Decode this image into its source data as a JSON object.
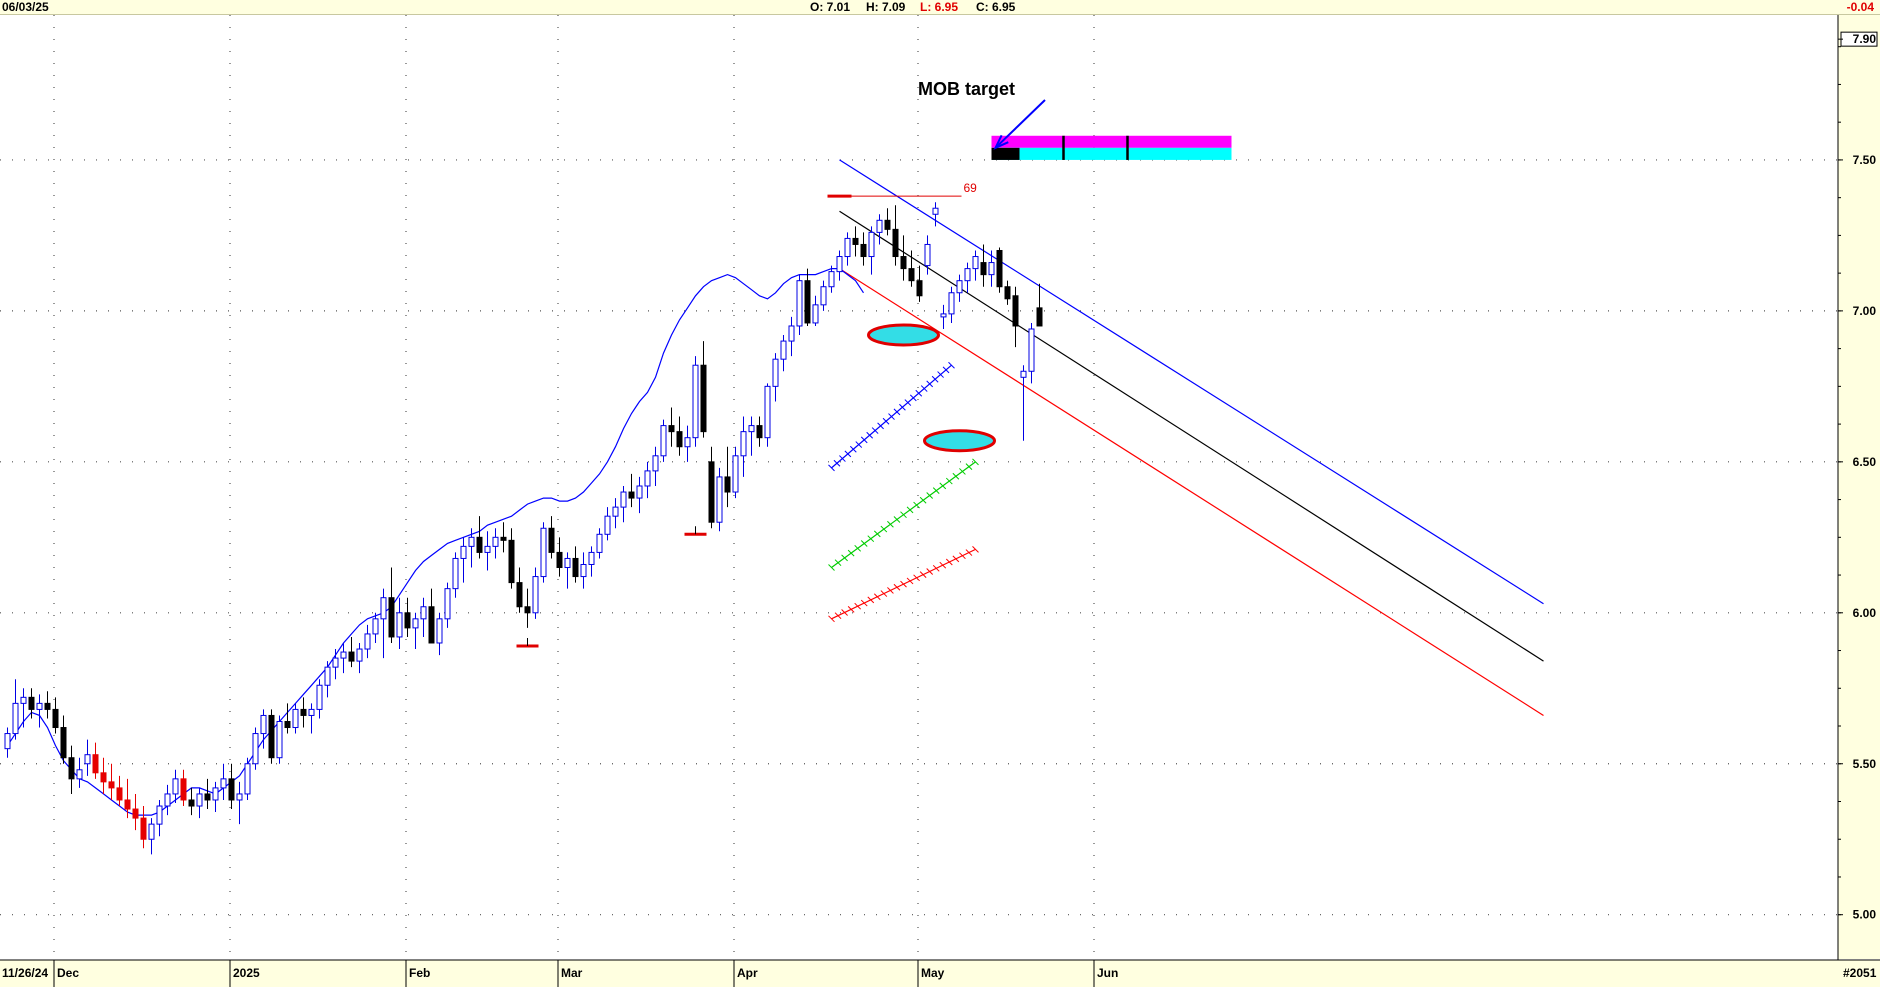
{
  "header": {
    "date": "06/03/25",
    "open": "O: 7.01",
    "high": "H: 7.09",
    "low": "L: 6.95",
    "close": "C: 6.95",
    "change": "-0.04"
  },
  "footer": {
    "start_date": "11/26/24",
    "chart_id": "#2051"
  },
  "annotations": {
    "mob_label": "MOB target",
    "swing_count": "69"
  },
  "colors": {
    "up_candle": "#0000e6",
    "down_candle": "#000000",
    "down_candle_alt": "#e60000",
    "moving_average": "#0000ff",
    "channel_upper": "#0000ff",
    "channel_mid": "#000000",
    "channel_lower": "#ff0000",
    "target_magenta": "#ff00ff",
    "target_cyan": "#00ffff",
    "header_bg": "#ffffe0"
  },
  "chart_data": {
    "type": "candlestick",
    "ylim": [
      4.85,
      7.98
    ],
    "y_ticks": [
      "7.90",
      "7.50",
      "7.00",
      "6.50",
      "6.00",
      "5.50",
      "5.00"
    ],
    "x_months": [
      "Dec",
      "2025",
      "Feb",
      "Mar",
      "Apr",
      "May",
      "Jun"
    ],
    "ohlc": [
      [
        5.55,
        5.62,
        5.52,
        5.6
      ],
      [
        5.6,
        5.78,
        5.58,
        5.7
      ],
      [
        5.7,
        5.75,
        5.62,
        5.72
      ],
      [
        5.72,
        5.75,
        5.65,
        5.68
      ],
      [
        5.68,
        5.73,
        5.62,
        5.7
      ],
      [
        5.7,
        5.74,
        5.65,
        5.68
      ],
      [
        5.68,
        5.72,
        5.6,
        5.62
      ],
      [
        5.62,
        5.66,
        5.5,
        5.52
      ],
      [
        5.52,
        5.56,
        5.4,
        5.45
      ],
      [
        5.45,
        5.52,
        5.42,
        5.48
      ],
      [
        5.5,
        5.58,
        5.46,
        5.53
      ],
      [
        5.53,
        5.57,
        5.45,
        5.47
      ],
      [
        5.47,
        5.52,
        5.4,
        5.44
      ],
      [
        5.44,
        5.5,
        5.38,
        5.42
      ],
      [
        5.42,
        5.46,
        5.36,
        5.38
      ],
      [
        5.38,
        5.45,
        5.32,
        5.35
      ],
      [
        5.35,
        5.4,
        5.28,
        5.32
      ],
      [
        5.32,
        5.36,
        5.22,
        5.25
      ],
      [
        5.25,
        5.32,
        5.2,
        5.3
      ],
      [
        5.3,
        5.38,
        5.26,
        5.36
      ],
      [
        5.36,
        5.43,
        5.33,
        5.4
      ],
      [
        5.4,
        5.48,
        5.37,
        5.45
      ],
      [
        5.45,
        5.48,
        5.36,
        5.38
      ],
      [
        5.38,
        5.42,
        5.33,
        5.36
      ],
      [
        5.36,
        5.42,
        5.32,
        5.4
      ],
      [
        5.4,
        5.45,
        5.35,
        5.38
      ],
      [
        5.38,
        5.44,
        5.34,
        5.42
      ],
      [
        5.42,
        5.5,
        5.38,
        5.45
      ],
      [
        5.45,
        5.5,
        5.35,
        5.38
      ],
      [
        5.38,
        5.44,
        5.3,
        5.4
      ],
      [
        5.4,
        5.52,
        5.38,
        5.5
      ],
      [
        5.5,
        5.62,
        5.48,
        5.6
      ],
      [
        5.6,
        5.68,
        5.55,
        5.66
      ],
      [
        5.66,
        5.68,
        5.5,
        5.52
      ],
      [
        5.52,
        5.66,
        5.5,
        5.64
      ],
      [
        5.64,
        5.7,
        5.6,
        5.62
      ],
      [
        5.62,
        5.7,
        5.6,
        5.68
      ],
      [
        5.68,
        5.72,
        5.62,
        5.66
      ],
      [
        5.66,
        5.7,
        5.6,
        5.68
      ],
      [
        5.68,
        5.78,
        5.65,
        5.76
      ],
      [
        5.76,
        5.84,
        5.72,
        5.82
      ],
      [
        5.82,
        5.88,
        5.78,
        5.85
      ],
      [
        5.85,
        5.9,
        5.8,
        5.87
      ],
      [
        5.87,
        5.92,
        5.82,
        5.84
      ],
      [
        5.84,
        5.9,
        5.8,
        5.88
      ],
      [
        5.88,
        5.96,
        5.85,
        5.93
      ],
      [
        5.93,
        6.0,
        5.9,
        5.98
      ],
      [
        5.98,
        6.08,
        5.85,
        6.05
      ],
      [
        6.05,
        6.15,
        5.9,
        5.92
      ],
      [
        5.92,
        6.05,
        5.88,
        6.0
      ],
      [
        6.0,
        6.05,
        5.92,
        5.95
      ],
      [
        5.95,
        6.0,
        5.88,
        5.98
      ],
      [
        5.98,
        6.05,
        5.92,
        6.02
      ],
      [
        6.02,
        6.08,
        5.98,
        5.9
      ],
      [
        5.9,
        6.0,
        5.86,
        5.98
      ],
      [
        5.98,
        6.1,
        5.95,
        6.08
      ],
      [
        6.08,
        6.2,
        6.05,
        6.18
      ],
      [
        6.18,
        6.25,
        6.1,
        6.22
      ],
      [
        6.22,
        6.28,
        6.15,
        6.25
      ],
      [
        6.25,
        6.32,
        6.18,
        6.2
      ],
      [
        6.2,
        6.27,
        6.14,
        6.22
      ],
      [
        6.22,
        6.28,
        6.18,
        6.25
      ],
      [
        6.25,
        6.3,
        6.2,
        6.24
      ],
      [
        6.24,
        6.28,
        6.08,
        6.1
      ],
      [
        6.1,
        6.15,
        6.0,
        6.02
      ],
      [
        6.02,
        6.08,
        5.95,
        6.0
      ],
      [
        6.0,
        6.15,
        5.98,
        6.12
      ],
      [
        6.12,
        6.3,
        6.1,
        6.28
      ],
      [
        6.28,
        6.32,
        6.18,
        6.2
      ],
      [
        6.2,
        6.25,
        6.12,
        6.15
      ],
      [
        6.15,
        6.2,
        6.08,
        6.18
      ],
      [
        6.18,
        6.22,
        6.1,
        6.12
      ],
      [
        6.12,
        6.2,
        6.08,
        6.16
      ],
      [
        6.16,
        6.22,
        6.12,
        6.2
      ],
      [
        6.2,
        6.28,
        6.18,
        6.26
      ],
      [
        6.26,
        6.35,
        6.24,
        6.32
      ],
      [
        6.32,
        6.38,
        6.28,
        6.35
      ],
      [
        6.35,
        6.42,
        6.3,
        6.4
      ],
      [
        6.4,
        6.46,
        6.35,
        6.38
      ],
      [
        6.38,
        6.45,
        6.33,
        6.42
      ],
      [
        6.42,
        6.5,
        6.38,
        6.47
      ],
      [
        6.47,
        6.55,
        6.42,
        6.52
      ],
      [
        6.52,
        6.64,
        6.5,
        6.62
      ],
      [
        6.62,
        6.68,
        6.55,
        6.6
      ],
      [
        6.6,
        6.65,
        6.52,
        6.55
      ],
      [
        6.55,
        6.62,
        6.5,
        6.58
      ],
      [
        6.58,
        6.85,
        6.55,
        6.82
      ],
      [
        6.82,
        6.9,
        6.58,
        6.6
      ],
      [
        6.5,
        6.55,
        6.28,
        6.3
      ],
      [
        6.3,
        6.48,
        6.27,
        6.45
      ],
      [
        6.45,
        6.55,
        6.35,
        6.4
      ],
      [
        6.4,
        6.55,
        6.38,
        6.52
      ],
      [
        6.52,
        6.65,
        6.45,
        6.6
      ],
      [
        6.6,
        6.65,
        6.52,
        6.62
      ],
      [
        6.62,
        6.65,
        6.55,
        6.58
      ],
      [
        6.58,
        6.76,
        6.55,
        6.75
      ],
      [
        6.75,
        6.86,
        6.7,
        6.84
      ],
      [
        6.84,
        6.92,
        6.8,
        6.9
      ],
      [
        6.9,
        6.98,
        6.85,
        6.95
      ],
      [
        6.95,
        7.12,
        6.92,
        7.1
      ],
      [
        7.1,
        7.14,
        6.95,
        6.96
      ],
      [
        6.96,
        7.05,
        6.95,
        7.02
      ],
      [
        7.02,
        7.1,
        7.0,
        7.08
      ],
      [
        7.08,
        7.15,
        7.06,
        7.13
      ],
      [
        7.13,
        7.2,
        7.1,
        7.18
      ],
      [
        7.18,
        7.26,
        7.15,
        7.24
      ],
      [
        7.24,
        7.28,
        7.18,
        7.22
      ],
      [
        7.22,
        7.26,
        7.15,
        7.18
      ],
      [
        7.18,
        7.28,
        7.12,
        7.26
      ],
      [
        7.26,
        7.32,
        7.22,
        7.3
      ],
      [
        7.3,
        7.34,
        7.25,
        7.27
      ],
      [
        7.27,
        7.35,
        7.15,
        7.18
      ],
      [
        7.18,
        7.25,
        7.1,
        7.14
      ],
      [
        7.14,
        7.2,
        7.08,
        7.1
      ],
      [
        7.1,
        7.15,
        7.03,
        7.05
      ],
      [
        7.15,
        7.25,
        7.12,
        7.22
      ],
      [
        7.32,
        7.36,
        7.28,
        7.34
      ],
      [
        6.98,
        7.02,
        6.94,
        6.99
      ],
      [
        6.99,
        7.08,
        6.96,
        7.06
      ],
      [
        7.06,
        7.12,
        7.03,
        7.1
      ],
      [
        7.1,
        7.16,
        7.06,
        7.14
      ],
      [
        7.14,
        7.2,
        7.1,
        7.18
      ],
      [
        7.16,
        7.22,
        7.08,
        7.12
      ],
      [
        7.12,
        7.2,
        7.08,
        7.16
      ],
      [
        7.2,
        7.21,
        7.06,
        7.08
      ],
      [
        7.08,
        7.1,
        7.02,
        7.04
      ],
      [
        7.05,
        7.08,
        6.88,
        6.95
      ],
      [
        6.78,
        6.82,
        6.57,
        6.8
      ],
      [
        6.8,
        6.96,
        6.76,
        6.94
      ],
      [
        7.01,
        7.09,
        6.95,
        6.95
      ]
    ],
    "moving_average": [
      5.56,
      5.6,
      5.64,
      5.67,
      5.66,
      5.62,
      5.56,
      5.51,
      5.48,
      5.45,
      5.44,
      5.42,
      5.4,
      5.38,
      5.36,
      5.34,
      5.33,
      5.33,
      5.33,
      5.34,
      5.36,
      5.38,
      5.4,
      5.42,
      5.42,
      5.41,
      5.4,
      5.42,
      5.44,
      5.46,
      5.5,
      5.54,
      5.58,
      5.61,
      5.64,
      5.67,
      5.7,
      5.73,
      5.76,
      5.79,
      5.82,
      5.86,
      5.9,
      5.93,
      5.96,
      5.98,
      5.99,
      6.0,
      6.02,
      6.06,
      6.1,
      6.14,
      6.17,
      6.19,
      6.21,
      6.23,
      6.24,
      6.25,
      6.26,
      6.27,
      6.29,
      6.3,
      6.31,
      6.32,
      6.34,
      6.36,
      6.37,
      6.38,
      6.38,
      6.37,
      6.37,
      6.38,
      6.4,
      6.43,
      6.46,
      6.5,
      6.55,
      6.61,
      6.66,
      6.7,
      6.73,
      6.78,
      6.86,
      6.92,
      6.97,
      7.01,
      7.05,
      7.08,
      7.1,
      7.11,
      7.12,
      7.11,
      7.09,
      7.07,
      7.05,
      7.04,
      7.06,
      7.09,
      7.11,
      7.12,
      7.12,
      7.12,
      7.13,
      7.14,
      7.14,
      7.12,
      7.1,
      7.06
    ],
    "ma_start_index": 0,
    "channel": {
      "upper": [
        [
          104,
          7.5
        ],
        [
          192,
          6.03
        ]
      ],
      "mid": [
        [
          104,
          7.33
        ],
        [
          192,
          5.84
        ]
      ],
      "lower": [
        [
          104,
          7.14
        ],
        [
          192,
          5.66
        ]
      ]
    },
    "swing_high": {
      "index": 104,
      "price": 7.38,
      "label_index": 119
    },
    "pivot_lows": [
      {
        "index": 65,
        "price": 5.89
      },
      {
        "index": 86,
        "price": 6.26
      }
    ],
    "ellipses": [
      {
        "index": 112,
        "price": 6.92
      },
      {
        "index": 119,
        "price": 6.57
      }
    ],
    "projection_ticks": [
      {
        "color": "#0000ff",
        "from": [
          103,
          6.48
        ],
        "to": [
          118,
          6.82
        ]
      },
      {
        "color": "#00cc00",
        "from": [
          103,
          6.15
        ],
        "to": [
          121,
          6.5
        ]
      },
      {
        "color": "#ff0000",
        "from": [
          103,
          5.98
        ],
        "to": [
          121,
          6.21
        ]
      }
    ],
    "target_zone": {
      "top": 7.58,
      "mid": 7.54,
      "bottom": 7.5,
      "start_index": 123,
      "end_index": 153,
      "markers": [
        132,
        140
      ]
    }
  }
}
